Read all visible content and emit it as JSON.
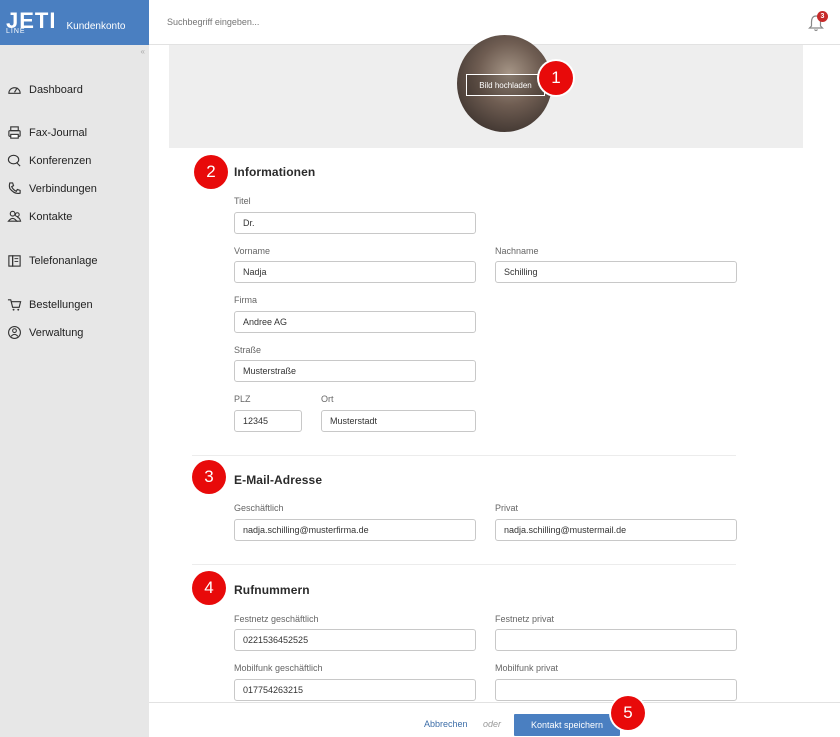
{
  "brand": {
    "name": "JETI",
    "sub": "LINE",
    "title": "Kundenkonto"
  },
  "search": {
    "placeholder": "Suchbegriff eingeben..."
  },
  "notifications": {
    "count": "3"
  },
  "sidebar": {
    "items": [
      {
        "label": "Dashboard",
        "icon": "gauge-icon"
      },
      {
        "label": "Fax-Journal",
        "icon": "printer-icon"
      },
      {
        "label": "Konferenzen",
        "icon": "chat-icon"
      },
      {
        "label": "Verbindungen",
        "icon": "phone-icon"
      },
      {
        "label": "Kontakte",
        "icon": "contacts-icon"
      },
      {
        "label": "Telefonanlage",
        "icon": "pbx-icon"
      },
      {
        "label": "Bestellungen",
        "icon": "cart-icon"
      },
      {
        "label": "Verwaltung",
        "icon": "settings-icon"
      }
    ]
  },
  "photo": {
    "upload_label": "Bild hochladen"
  },
  "markers": [
    "1",
    "2",
    "3",
    "4",
    "5"
  ],
  "info": {
    "title": "Informationen",
    "titel_label": "Titel",
    "titel_value": "Dr.",
    "vorname_label": "Vorname",
    "vorname_value": "Nadja",
    "nachname_label": "Nachname",
    "nachname_value": "Schilling",
    "firma_label": "Firma",
    "firma_value": "Andree AG",
    "strasse_label": "Straße",
    "strasse_value": "Musterstraße",
    "plz_label": "PLZ",
    "plz_value": "12345",
    "ort_label": "Ort",
    "ort_value": "Musterstadt"
  },
  "email": {
    "title": "E-Mail-Adresse",
    "business_label": "Geschäftlich",
    "business_value": "nadja.schilling@musterfirma.de",
    "private_label": "Privat",
    "private_value": "nadja.schilling@mustermail.de"
  },
  "phone": {
    "title": "Rufnummern",
    "landline_business_label": "Festnetz geschäftlich",
    "landline_business_value": "0221536452525",
    "landline_private_label": "Festnetz privat",
    "landline_private_value": "",
    "mobile_business_label": "Mobilfunk geschäftlich",
    "mobile_business_value": "017754263215",
    "mobile_private_label": "Mobilfunk privat",
    "mobile_private_value": ""
  },
  "footer": {
    "cancel_label": "Abbrechen",
    "or_label": "oder",
    "save_label": "Kontakt speichern"
  },
  "colors": {
    "accent": "#4a7fc1",
    "marker": "#e80a0a",
    "badge": "#c62a2a"
  }
}
